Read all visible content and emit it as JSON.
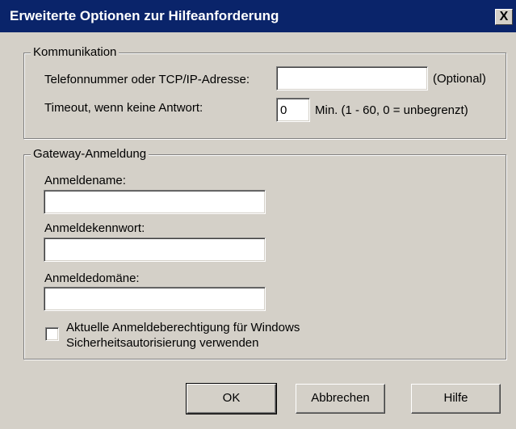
{
  "window": {
    "title": "Erweiterte Optionen zur Hilfeanforderung",
    "close_label": "X"
  },
  "communication": {
    "group_label": "Kommunikation",
    "phone_label": "Telefonnummer oder TCP/IP-Adresse:",
    "phone_value": "",
    "phone_hint": "(Optional)",
    "timeout_label": "Timeout, wenn keine Antwort:",
    "timeout_value": "0",
    "timeout_hint": "Min. (1 - 60,  0 = unbegrenzt)"
  },
  "gateway": {
    "group_label": "Gateway-Anmeldung",
    "name_label": "Anmeldename:",
    "name_value": "",
    "password_label": "Anmeldekennwort:",
    "password_value": "",
    "domain_label": "Anmeldedomäne:",
    "domain_value": "",
    "checkbox_label_line1": "Aktuelle Anmeldeberechtigung für Windows",
    "checkbox_label_line2": "Sicherheitsautorisierung verwenden",
    "checkbox_checked": false
  },
  "buttons": {
    "ok": "OK",
    "cancel": "Abbrechen",
    "help": "Hilfe"
  }
}
